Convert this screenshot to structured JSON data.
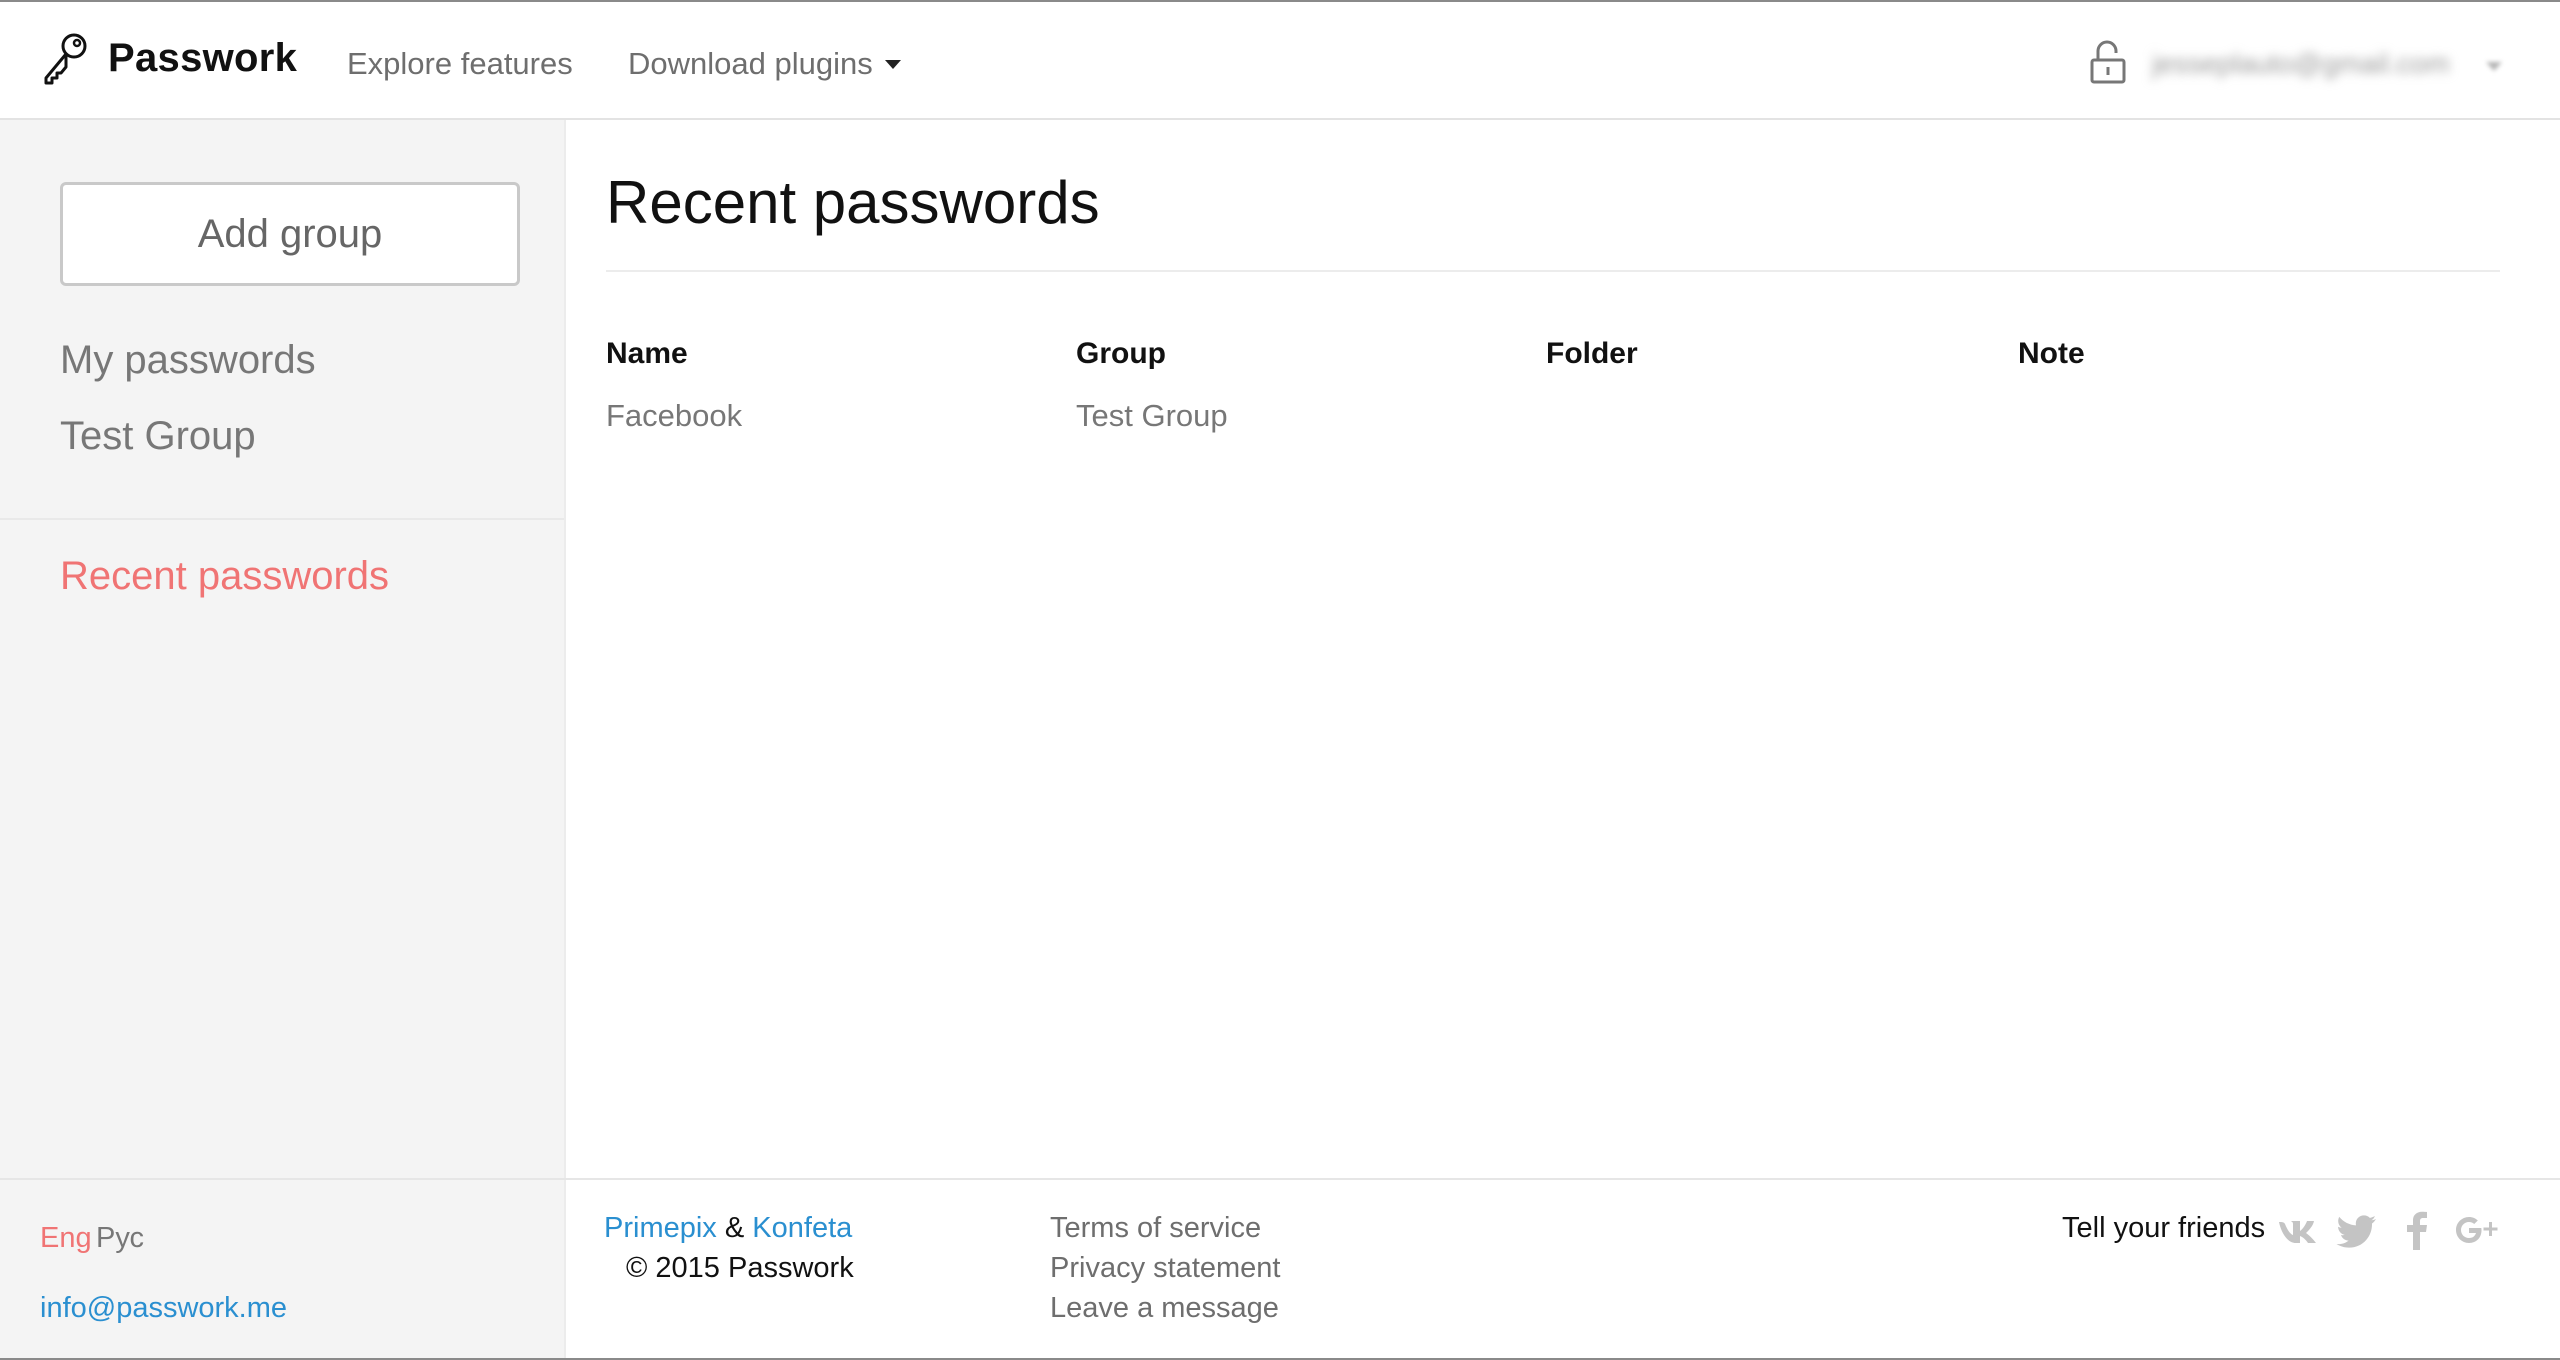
{
  "header": {
    "brand": "Passwork",
    "nav": {
      "explore": "Explore features",
      "download": "Download plugins"
    },
    "user_email": "jesseplauto@gmail.com"
  },
  "sidebar": {
    "add_group_label": "Add group",
    "items": [
      {
        "label": "My passwords"
      },
      {
        "label": "Test Group"
      }
    ],
    "recent_label": "Recent passwords"
  },
  "main": {
    "title": "Recent passwords",
    "columns": [
      "Name",
      "Group",
      "Folder",
      "Note"
    ],
    "rows": [
      {
        "name": "Facebook",
        "group": "Test Group",
        "folder": "",
        "note": ""
      }
    ]
  },
  "footer": {
    "lang_active": "Eng",
    "lang_other": "Рус",
    "contact_email": "info@passwork.me",
    "credit_primepix": "Primepix",
    "credit_amp": "&",
    "credit_konfeta": "Konfeta",
    "copyright": "© 2015 Passwork",
    "links": {
      "terms": "Terms of service",
      "privacy": "Privacy statement",
      "leave": "Leave a message"
    },
    "tell_friends": "Tell your friends",
    "social_icons": [
      "vk-icon",
      "twitter-icon",
      "facebook-icon",
      "google-plus-icon"
    ]
  },
  "colors": {
    "accent_red": "#f07474",
    "link_blue": "#2a8fd0",
    "sidebar_bg": "#f4f4f4",
    "muted_text": "#777777"
  }
}
